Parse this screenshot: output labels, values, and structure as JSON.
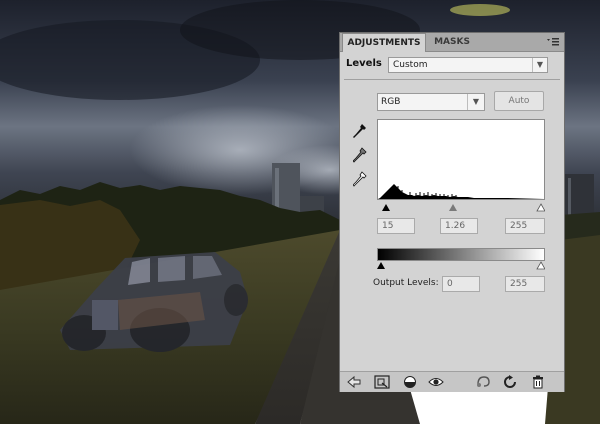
{
  "panel": {
    "tabs": [
      {
        "label": "ADJUSTMENTS",
        "active": true
      },
      {
        "label": "MASKS",
        "active": false
      }
    ],
    "menu_icon": "panel-menu-icon",
    "levels_label": "Levels",
    "preset": {
      "value": "Custom"
    },
    "channel": {
      "value": "RGB"
    },
    "auto_label": "Auto",
    "input_levels": {
      "black": "15",
      "gamma": "1.26",
      "white": "255"
    },
    "output_levels": {
      "label": "Output Levels:",
      "black": "0",
      "white": "255"
    },
    "eyedroppers": [
      "black-point-eyedropper-icon",
      "gray-point-eyedropper-icon",
      "white-point-eyedropper-icon"
    ],
    "bottom_icons": [
      "back-arrow-icon",
      "expand-view-icon",
      "clip-to-layer-icon",
      "visibility-eye-icon",
      "previous-state-icon",
      "reset-icon",
      "trash-icon"
    ]
  }
}
